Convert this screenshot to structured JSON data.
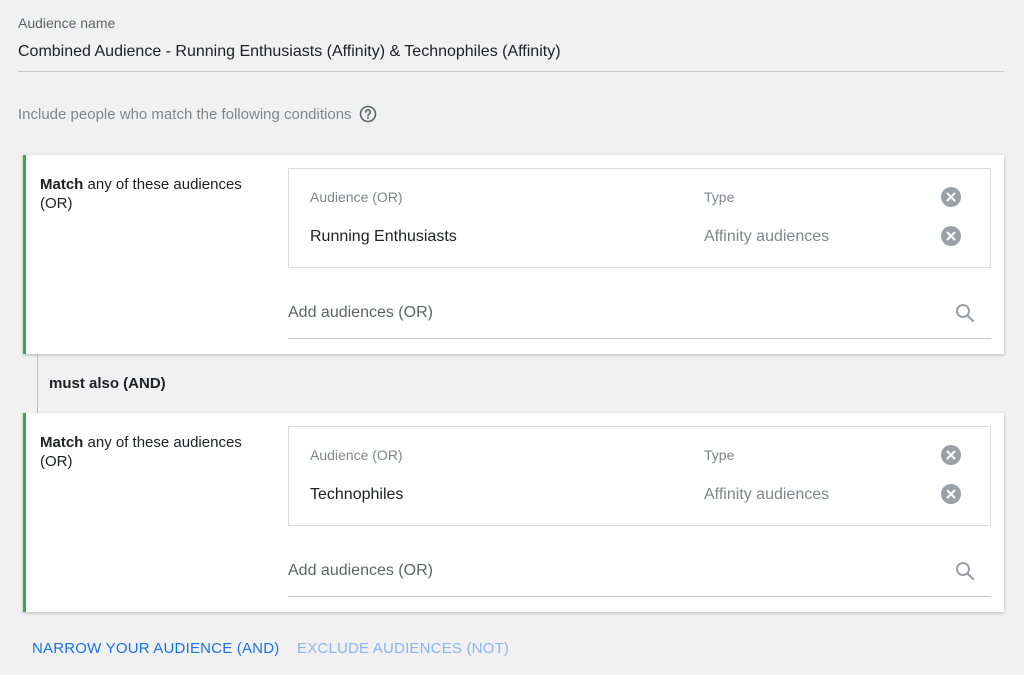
{
  "audience_name": {
    "label": "Audience name",
    "value": "Combined Audience - Running Enthusiasts (Affinity) & Technophiles (Affinity)"
  },
  "include_text": "Include people who match the following conditions",
  "groups": [
    {
      "title_bold": "Match",
      "title_rest": " any of these audiences (OR)",
      "col_audience": "Audience (OR)",
      "col_type": "Type",
      "rows": [
        {
          "audience": "Running Enthusiasts",
          "type": "Affinity audiences"
        }
      ],
      "add_placeholder": "Add audiences (OR)"
    },
    {
      "title_bold": "Match",
      "title_rest": " any of these audiences (OR)",
      "col_audience": "Audience (OR)",
      "col_type": "Type",
      "rows": [
        {
          "audience": "Technophiles",
          "type": "Affinity audiences"
        }
      ],
      "add_placeholder": "Add audiences (OR)"
    }
  ],
  "connector_label": "must also (AND)",
  "actions": {
    "narrow": "NARROW YOUR AUDIENCE (AND)",
    "exclude": "EXCLUDE AUDIENCES (NOT)"
  },
  "colors": {
    "accent_green": "#34a853",
    "link_blue": "#1a73e8",
    "link_blue_disabled": "#8ab4f8"
  },
  "icons": [
    "help-circle-icon",
    "remove-circle-icon",
    "search-icon"
  ]
}
